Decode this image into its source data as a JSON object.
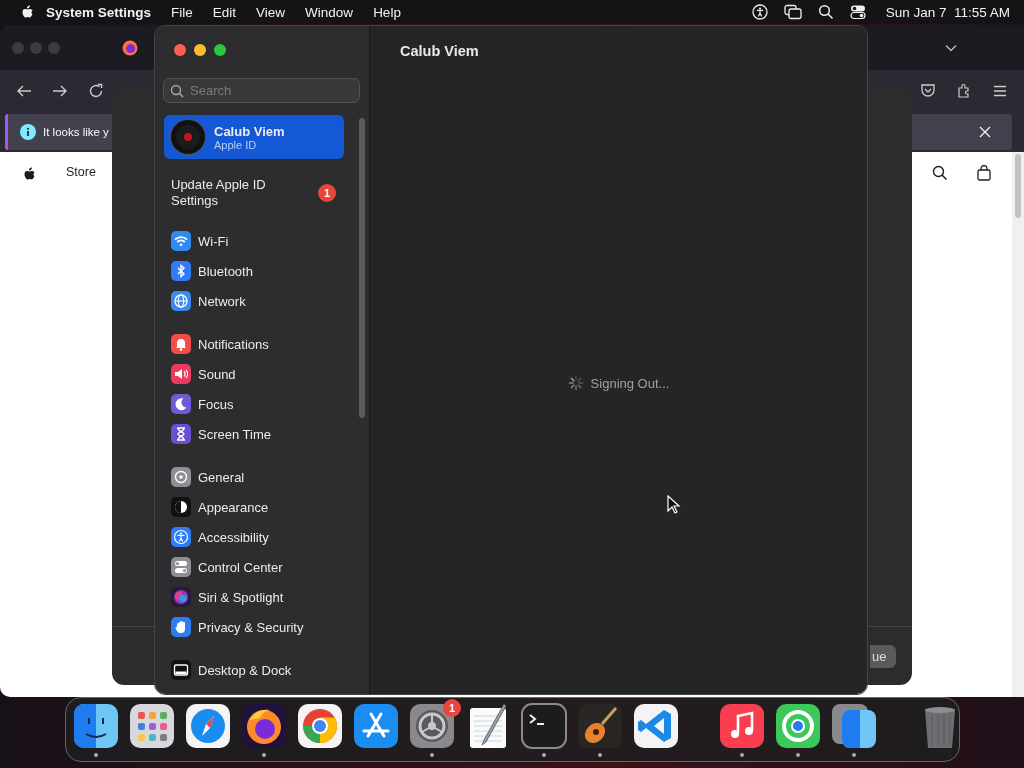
{
  "menu_bar": {
    "app": "System Settings",
    "menus": [
      "File",
      "Edit",
      "View",
      "Window",
      "Help"
    ],
    "clock": "Sun Jan 7  11:55 AM"
  },
  "browser": {
    "notice": "It looks like y",
    "nav": [
      "Store"
    ]
  },
  "sheet": {
    "button": "ue"
  },
  "settings": {
    "title": "Calub Viem",
    "search": {
      "placeholder": "Search"
    },
    "account": {
      "name": "Calub Viem",
      "subtitle": "Apple ID",
      "selected": true
    },
    "alert": {
      "label": "Update Apple ID Settings",
      "badge": "1",
      "selected": false
    },
    "groups": [
      [
        {
          "label": "Wi-Fi",
          "kind": "wifi",
          "selected": false
        },
        {
          "label": "Bluetooth",
          "kind": "bluetooth",
          "selected": false
        },
        {
          "label": "Network",
          "kind": "network",
          "selected": false
        }
      ],
      [
        {
          "label": "Notifications",
          "kind": "notifications",
          "selected": false
        },
        {
          "label": "Sound",
          "kind": "sound",
          "selected": false
        },
        {
          "label": "Focus",
          "kind": "focus",
          "selected": false
        },
        {
          "label": "Screen Time",
          "kind": "screentime",
          "selected": false
        }
      ],
      [
        {
          "label": "General",
          "kind": "general",
          "selected": false
        },
        {
          "label": "Appearance",
          "kind": "appearance",
          "selected": false
        },
        {
          "label": "Accessibility",
          "kind": "accessibility",
          "selected": false
        },
        {
          "label": "Control Center",
          "kind": "controlcenter",
          "selected": false
        },
        {
          "label": "Siri & Spotlight",
          "kind": "siri",
          "selected": false
        },
        {
          "label": "Privacy & Security",
          "kind": "privacy",
          "selected": false
        }
      ],
      [
        {
          "label": "Desktop & Dock",
          "kind": "desktop",
          "selected": false
        }
      ]
    ],
    "status": "Signing Out..."
  },
  "dock": {
    "items": [
      {
        "kind": "finder",
        "running": true
      },
      {
        "kind": "launchpad",
        "running": false
      },
      {
        "kind": "safari",
        "running": false
      },
      {
        "kind": "firefox",
        "running": true
      },
      {
        "kind": "chrome",
        "running": false
      },
      {
        "kind": "appstore",
        "running": false
      },
      {
        "kind": "settings",
        "running": true,
        "badge": "1"
      },
      {
        "kind": "textedit",
        "running": false
      },
      {
        "kind": "terminal",
        "running": true
      },
      {
        "kind": "garageband",
        "running": true
      },
      {
        "kind": "vscode",
        "running": false
      },
      {
        "kind": "separator"
      },
      {
        "kind": "music",
        "running": true
      },
      {
        "kind": "findmy",
        "running": true
      },
      {
        "kind": "finder2",
        "running": true
      },
      {
        "kind": "separator"
      },
      {
        "kind": "trash",
        "running": false
      }
    ]
  }
}
